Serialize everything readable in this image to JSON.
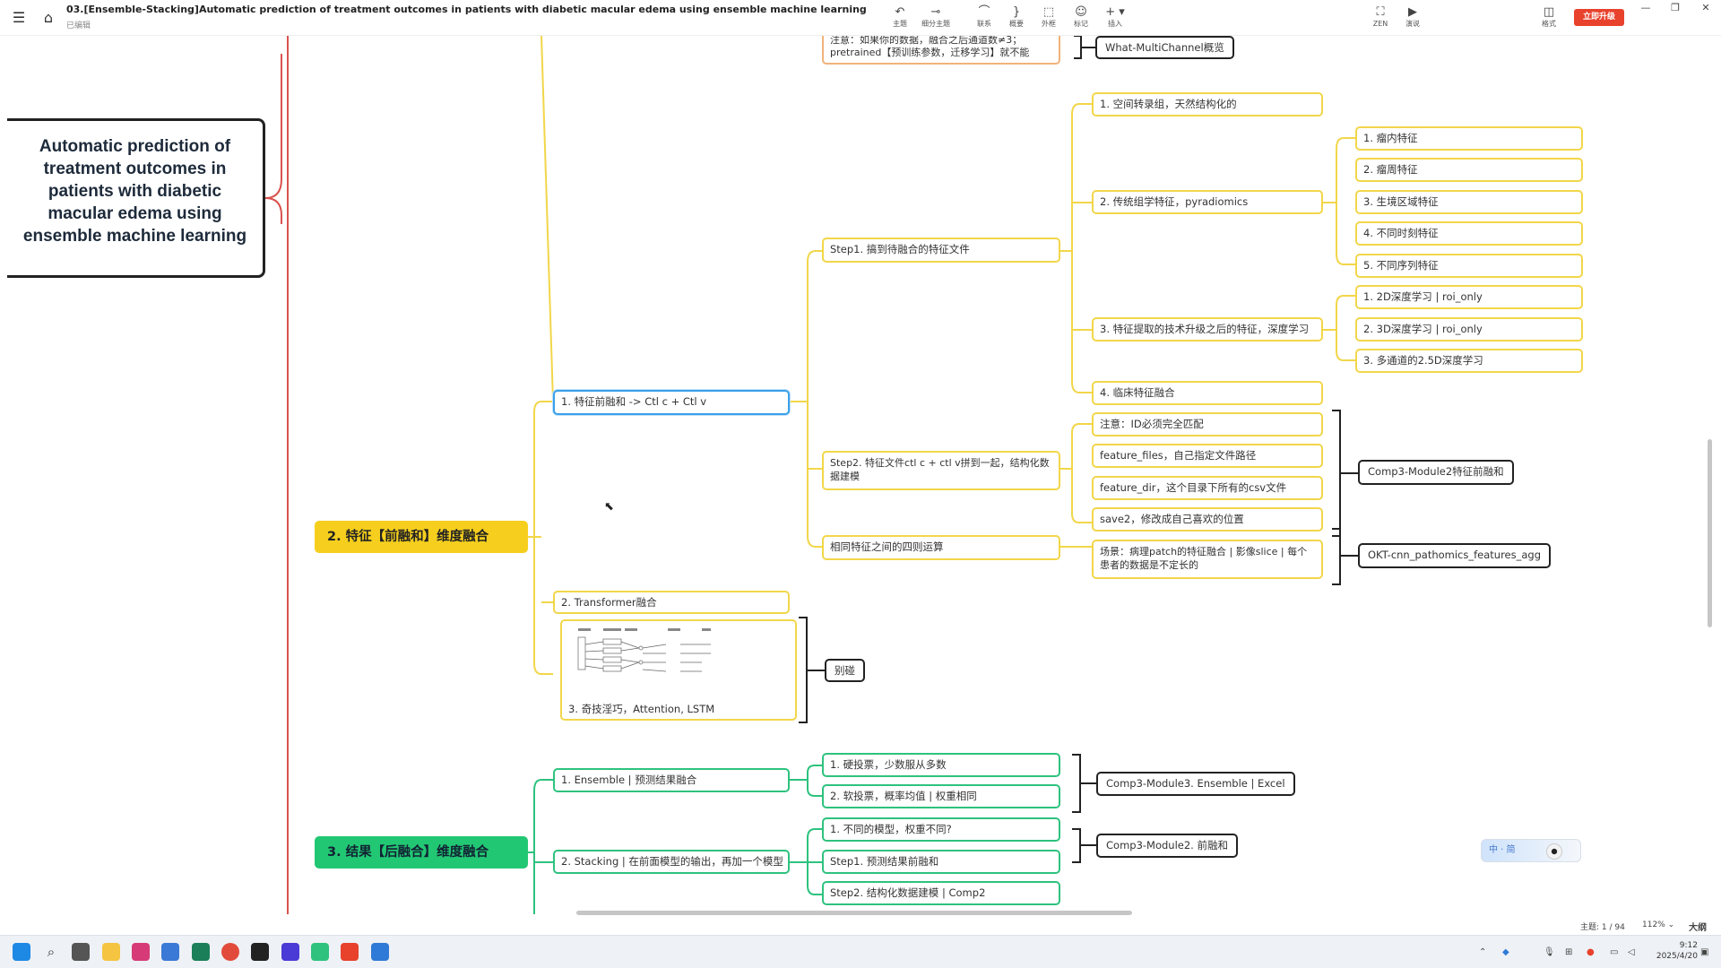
{
  "titlebar": {
    "doc_title": "03.[Ensemble-Stacking]Automatic prediction of treatment outcomes in patients with diabetic macular edema using ensemble machine learning",
    "doc_status": "已编辑",
    "tools": [
      "主题",
      "细分主题",
      "联系",
      "概要",
      "外框",
      "标记",
      "插入"
    ],
    "view_tools": [
      "ZEN",
      "演说"
    ],
    "format_label": "格式",
    "upgrade_label": "立即升级"
  },
  "root": {
    "title": "Automatic prediction of treatment outcomes in patients with diabetic macular edema using ensemble machine learning"
  },
  "top_partial": {
    "note": "注意：如果你的数据，融合之后通道数≠3；pretrained【预训练参数，迁移学习】就不能",
    "ref": "What-MultiChannel概览"
  },
  "branch_feature": {
    "label": "2. 特征【前融和】维度融合",
    "sub1": {
      "label": "1. 特征前融和 -> Ctl c + Ctl v",
      "step1": {
        "label": "Step1. 搞到待融合的特征文件",
        "items": {
          "a": "1. 空间转录组，天然结构化的",
          "b": "2. 传统组学特征，pyradiomics",
          "b_children": [
            "1. 瘤内特征",
            "2. 瘤周特征",
            "3. 生境区域特征",
            "4. 不同时刻特征",
            "5. 不同序列特征"
          ],
          "c": "3. 特征提取的技术升级之后的特征，深度学习",
          "c_children": [
            "1. 2D深度学习 | roi_only",
            "2. 3D深度学习 | roi_only",
            "3. 多通道的2.5D深度学习"
          ],
          "d": "4. 临床特征融合"
        }
      },
      "step2": {
        "label": "Step2. 特征文件ctl c + ctl v拼到一起，结构化数据建模",
        "items": [
          "注意：ID必须完全匹配",
          "feature_files，自己指定文件路径",
          "feature_dir，这个目录下所有的csv文件",
          "save2，修改成自己喜欢的位置"
        ],
        "ref": "Comp3-Module2特征前融和"
      },
      "arith": {
        "label": "相同特征之间的四则运算",
        "scene": "场景：病理patch的特征融合 | 影像slice | 每个患者的数据是不定长的",
        "ref": "OKT-cnn_pathomics_features_agg"
      }
    },
    "sub2": "2. Transformer融合",
    "sub3": "3. 奇技淫巧，Attention, LSTM",
    "sub3_ref": "别碰"
  },
  "branch_result": {
    "label": "3. 结果【后融合】维度融合",
    "ensemble": {
      "label": "1. Ensemble | 预测结果融合",
      "items": [
        "1. 硬投票，少数服从多数",
        "2. 软投票，概率均值 | 权重相同"
      ],
      "ref": "Comp3-Module3. Ensemble | Excel"
    },
    "stacking": {
      "label": "2. Stacking | 在前面模型的输出，再加一个模型",
      "items": [
        "1. 不同的模型，权重不同?",
        "Step1. 预测结果前融和",
        "Step2. 结构化数据建模 | Comp2"
      ],
      "ref": "Comp3-Module2. 前融和"
    }
  },
  "widget": {
    "label": "中 · 简"
  },
  "statusbar": {
    "topic_count": "主题: 1 / 94",
    "zoom": "112%",
    "outline": "大纲"
  },
  "clock": {
    "time": "9:12",
    "date": "2025/4/20"
  },
  "colors": {
    "feature_branch": "#f6cf1e",
    "result_branch": "#22c773",
    "root_line": "#d9534f",
    "upgrade": "#e8412c"
  }
}
